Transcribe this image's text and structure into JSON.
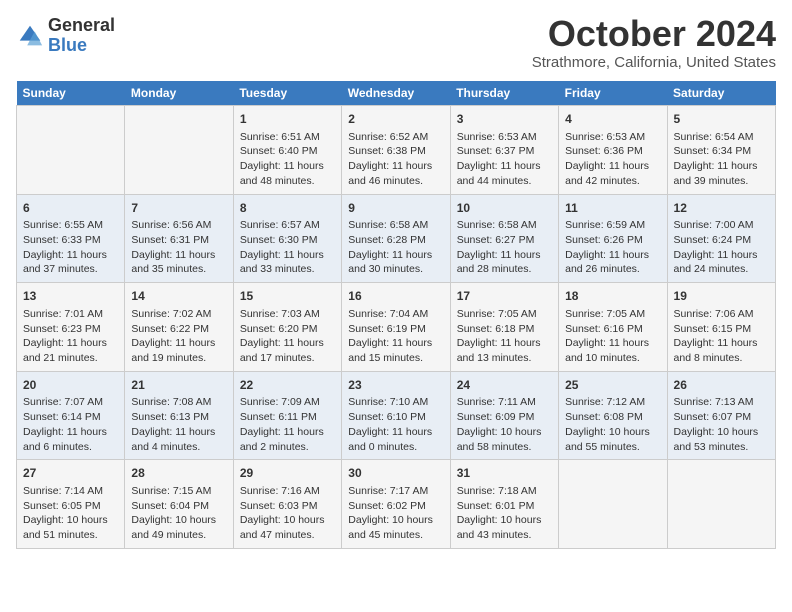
{
  "header": {
    "logo_line1": "General",
    "logo_line2": "Blue",
    "month": "October 2024",
    "location": "Strathmore, California, United States"
  },
  "weekdays": [
    "Sunday",
    "Monday",
    "Tuesday",
    "Wednesday",
    "Thursday",
    "Friday",
    "Saturday"
  ],
  "weeks": [
    [
      {
        "day": "",
        "info": ""
      },
      {
        "day": "",
        "info": ""
      },
      {
        "day": "1",
        "info": "Sunrise: 6:51 AM\nSunset: 6:40 PM\nDaylight: 11 hours and 48 minutes."
      },
      {
        "day": "2",
        "info": "Sunrise: 6:52 AM\nSunset: 6:38 PM\nDaylight: 11 hours and 46 minutes."
      },
      {
        "day": "3",
        "info": "Sunrise: 6:53 AM\nSunset: 6:37 PM\nDaylight: 11 hours and 44 minutes."
      },
      {
        "day": "4",
        "info": "Sunrise: 6:53 AM\nSunset: 6:36 PM\nDaylight: 11 hours and 42 minutes."
      },
      {
        "day": "5",
        "info": "Sunrise: 6:54 AM\nSunset: 6:34 PM\nDaylight: 11 hours and 39 minutes."
      }
    ],
    [
      {
        "day": "6",
        "info": "Sunrise: 6:55 AM\nSunset: 6:33 PM\nDaylight: 11 hours and 37 minutes."
      },
      {
        "day": "7",
        "info": "Sunrise: 6:56 AM\nSunset: 6:31 PM\nDaylight: 11 hours and 35 minutes."
      },
      {
        "day": "8",
        "info": "Sunrise: 6:57 AM\nSunset: 6:30 PM\nDaylight: 11 hours and 33 minutes."
      },
      {
        "day": "9",
        "info": "Sunrise: 6:58 AM\nSunset: 6:28 PM\nDaylight: 11 hours and 30 minutes."
      },
      {
        "day": "10",
        "info": "Sunrise: 6:58 AM\nSunset: 6:27 PM\nDaylight: 11 hours and 28 minutes."
      },
      {
        "day": "11",
        "info": "Sunrise: 6:59 AM\nSunset: 6:26 PM\nDaylight: 11 hours and 26 minutes."
      },
      {
        "day": "12",
        "info": "Sunrise: 7:00 AM\nSunset: 6:24 PM\nDaylight: 11 hours and 24 minutes."
      }
    ],
    [
      {
        "day": "13",
        "info": "Sunrise: 7:01 AM\nSunset: 6:23 PM\nDaylight: 11 hours and 21 minutes."
      },
      {
        "day": "14",
        "info": "Sunrise: 7:02 AM\nSunset: 6:22 PM\nDaylight: 11 hours and 19 minutes."
      },
      {
        "day": "15",
        "info": "Sunrise: 7:03 AM\nSunset: 6:20 PM\nDaylight: 11 hours and 17 minutes."
      },
      {
        "day": "16",
        "info": "Sunrise: 7:04 AM\nSunset: 6:19 PM\nDaylight: 11 hours and 15 minutes."
      },
      {
        "day": "17",
        "info": "Sunrise: 7:05 AM\nSunset: 6:18 PM\nDaylight: 11 hours and 13 minutes."
      },
      {
        "day": "18",
        "info": "Sunrise: 7:05 AM\nSunset: 6:16 PM\nDaylight: 11 hours and 10 minutes."
      },
      {
        "day": "19",
        "info": "Sunrise: 7:06 AM\nSunset: 6:15 PM\nDaylight: 11 hours and 8 minutes."
      }
    ],
    [
      {
        "day": "20",
        "info": "Sunrise: 7:07 AM\nSunset: 6:14 PM\nDaylight: 11 hours and 6 minutes."
      },
      {
        "day": "21",
        "info": "Sunrise: 7:08 AM\nSunset: 6:13 PM\nDaylight: 11 hours and 4 minutes."
      },
      {
        "day": "22",
        "info": "Sunrise: 7:09 AM\nSunset: 6:11 PM\nDaylight: 11 hours and 2 minutes."
      },
      {
        "day": "23",
        "info": "Sunrise: 7:10 AM\nSunset: 6:10 PM\nDaylight: 11 hours and 0 minutes."
      },
      {
        "day": "24",
        "info": "Sunrise: 7:11 AM\nSunset: 6:09 PM\nDaylight: 10 hours and 58 minutes."
      },
      {
        "day": "25",
        "info": "Sunrise: 7:12 AM\nSunset: 6:08 PM\nDaylight: 10 hours and 55 minutes."
      },
      {
        "day": "26",
        "info": "Sunrise: 7:13 AM\nSunset: 6:07 PM\nDaylight: 10 hours and 53 minutes."
      }
    ],
    [
      {
        "day": "27",
        "info": "Sunrise: 7:14 AM\nSunset: 6:05 PM\nDaylight: 10 hours and 51 minutes."
      },
      {
        "day": "28",
        "info": "Sunrise: 7:15 AM\nSunset: 6:04 PM\nDaylight: 10 hours and 49 minutes."
      },
      {
        "day": "29",
        "info": "Sunrise: 7:16 AM\nSunset: 6:03 PM\nDaylight: 10 hours and 47 minutes."
      },
      {
        "day": "30",
        "info": "Sunrise: 7:17 AM\nSunset: 6:02 PM\nDaylight: 10 hours and 45 minutes."
      },
      {
        "day": "31",
        "info": "Sunrise: 7:18 AM\nSunset: 6:01 PM\nDaylight: 10 hours and 43 minutes."
      },
      {
        "day": "",
        "info": ""
      },
      {
        "day": "",
        "info": ""
      }
    ]
  ]
}
